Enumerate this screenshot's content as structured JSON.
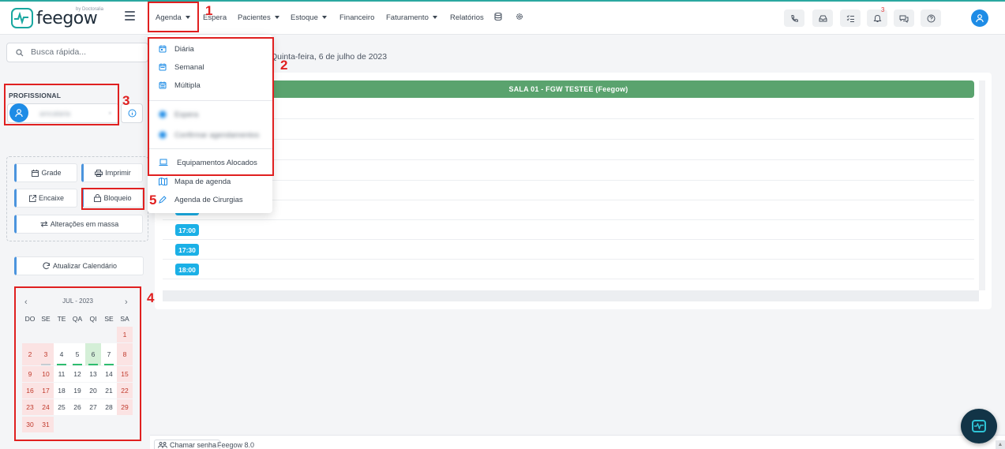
{
  "brand": {
    "name": "feegow",
    "by": "by Doctoralia"
  },
  "nav": {
    "items": [
      {
        "label": "Agenda",
        "caret": true
      },
      {
        "label": "Espera",
        "caret": false
      },
      {
        "label": "Pacientes",
        "caret": true
      },
      {
        "label": "Estoque",
        "caret": true
      },
      {
        "label": "Financeiro",
        "caret": false
      },
      {
        "label": "Faturamento",
        "caret": true
      },
      {
        "label": "Relatórios",
        "caret": false
      }
    ]
  },
  "topbar": {
    "notifications_count": "3"
  },
  "search": {
    "placeholder": "Busca rápida..."
  },
  "professional": {
    "label": "PROFISSIONAL",
    "name": "amcalaria",
    "clear": "×"
  },
  "actions": {
    "grade": "Grade",
    "imprimir": "Imprimir",
    "encaixe": "Encaixe",
    "bloqueio": "Bloqueio",
    "alteracoes": "Alterações em massa",
    "atualizar": "Atualizar Calendário"
  },
  "calendar": {
    "month": "JUL - 2023",
    "weekdays": [
      "DO",
      "SE",
      "TE",
      "QA",
      "QI",
      "SE",
      "SA"
    ],
    "weeks": [
      [
        "",
        "",
        "",
        "",
        "",
        "",
        "1"
      ],
      [
        "2",
        "3",
        "4",
        "5",
        "6",
        "7",
        "8"
      ],
      [
        "9",
        "10",
        "11",
        "12",
        "13",
        "14",
        "15"
      ],
      [
        "16",
        "17",
        "18",
        "19",
        "20",
        "21",
        "22"
      ],
      [
        "23",
        "24",
        "25",
        "26",
        "27",
        "28",
        "29"
      ],
      [
        "30",
        "31",
        "",
        "",
        "",
        "",
        ""
      ]
    ]
  },
  "main": {
    "date": "Quinta-feira, 6 de julho de 2023",
    "room": "SALA 01 - FGW TESTEE (Feegow)",
    "slots": [
      "17:00",
      "17:30",
      "18:00"
    ]
  },
  "dropdown": {
    "diaria": "Diária",
    "semanal": "Semanal",
    "multipla": "Múltipla",
    "blur1": "Espera",
    "blur2": "Confirmar agendamentos",
    "equip": "Equipamentos Alocados",
    "mapa": "Mapa de agenda",
    "cirurgias": "Agenda de Cirurgias"
  },
  "annotations": [
    "1",
    "2",
    "3",
    "4",
    "5"
  ],
  "footer": {
    "chamar": "Chamar senha",
    "version": "Feegow 8.0"
  },
  "colors": {
    "accent": "#19a7a0",
    "primary": "#1e8ce6",
    "slot": "#1bb0e6",
    "room": "#5aa36e",
    "annotation": "#e02020"
  }
}
